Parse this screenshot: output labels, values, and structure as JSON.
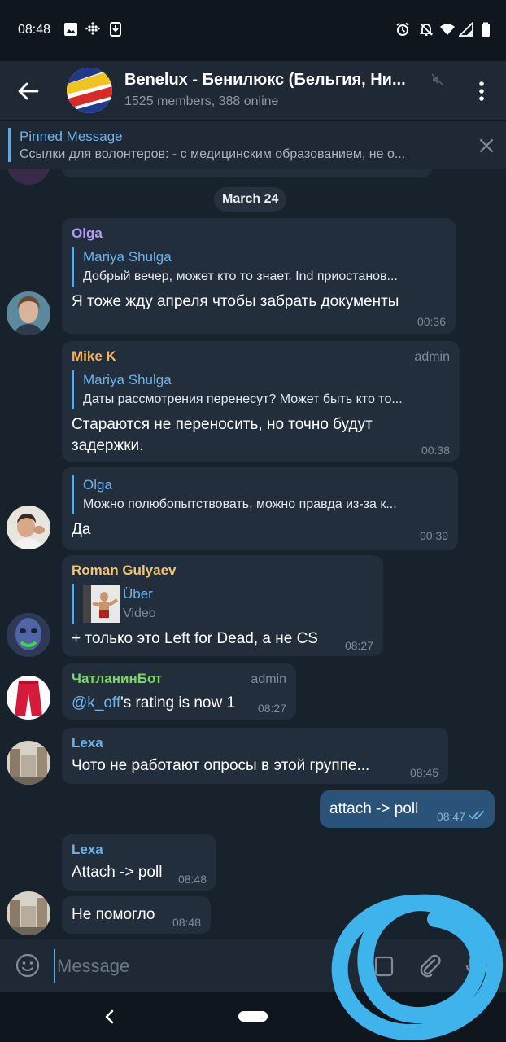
{
  "status_bar": {
    "time": "08:48"
  },
  "header": {
    "title": "Benelux - Бенилюкс (Бельгия, Ни...",
    "subtitle": "1525 members, 388 online"
  },
  "pinned": {
    "title": "Pinned Message",
    "text": "Ссылки для волонтеров: - с медицинским образованием, не о..."
  },
  "date_separator": "March 24",
  "messages": [
    {
      "sender": "Olga",
      "reply_name": "Mariya Shulga",
      "reply_text": "Добрый вечер, может кто то знает. Ind приостанов...",
      "text": "Я тоже жду апреля чтобы забрать документы",
      "time": "00:36"
    },
    {
      "sender": "Mike K",
      "tag": "admin",
      "reply_name": "Mariya Shulga",
      "reply_text": "Даты рассмотрения перенесут? Может быть кто то...",
      "text_line1": "Стараются не переносить, но точно будут",
      "text_line2": "задержки.",
      "time": "00:38"
    },
    {
      "reply_name": "Olga",
      "reply_text": "Можно полюбопытствовать, можно правда из-за к...",
      "text": "Да",
      "time": "00:39"
    },
    {
      "sender": "Roman Gulyaev",
      "reply_name": "Über",
      "reply_text": "Video",
      "text": "+ только это Left for Dead, а не CS",
      "time": "08:27"
    },
    {
      "sender": "ЧатланинБот",
      "tag": "admin",
      "mention": "@k_off",
      "text": "'s rating is now 1",
      "time": "08:27"
    },
    {
      "sender": "Lexa",
      "text": "Чото не работают опросы в этой группе...",
      "time": "08:45"
    },
    {
      "text": "attach -> poll",
      "time": "08:47"
    },
    {
      "sender": "Lexa",
      "text": "Attach -> poll",
      "time": "08:48"
    },
    {
      "text": "Не помогло",
      "time": "08:48"
    }
  ],
  "input": {
    "placeholder": "Message"
  },
  "colors": {
    "background": "#18222d",
    "bubble_in": "#232e3c",
    "bubble_out": "#2b5278",
    "accent": "#6cb4ec",
    "olga": "#b29cf5",
    "mike": "#f5b55b",
    "roman": "#f5c46c",
    "bot": "#7fd56a",
    "lexa": "#6cb4ec",
    "scribble": "#3fb4ec"
  }
}
